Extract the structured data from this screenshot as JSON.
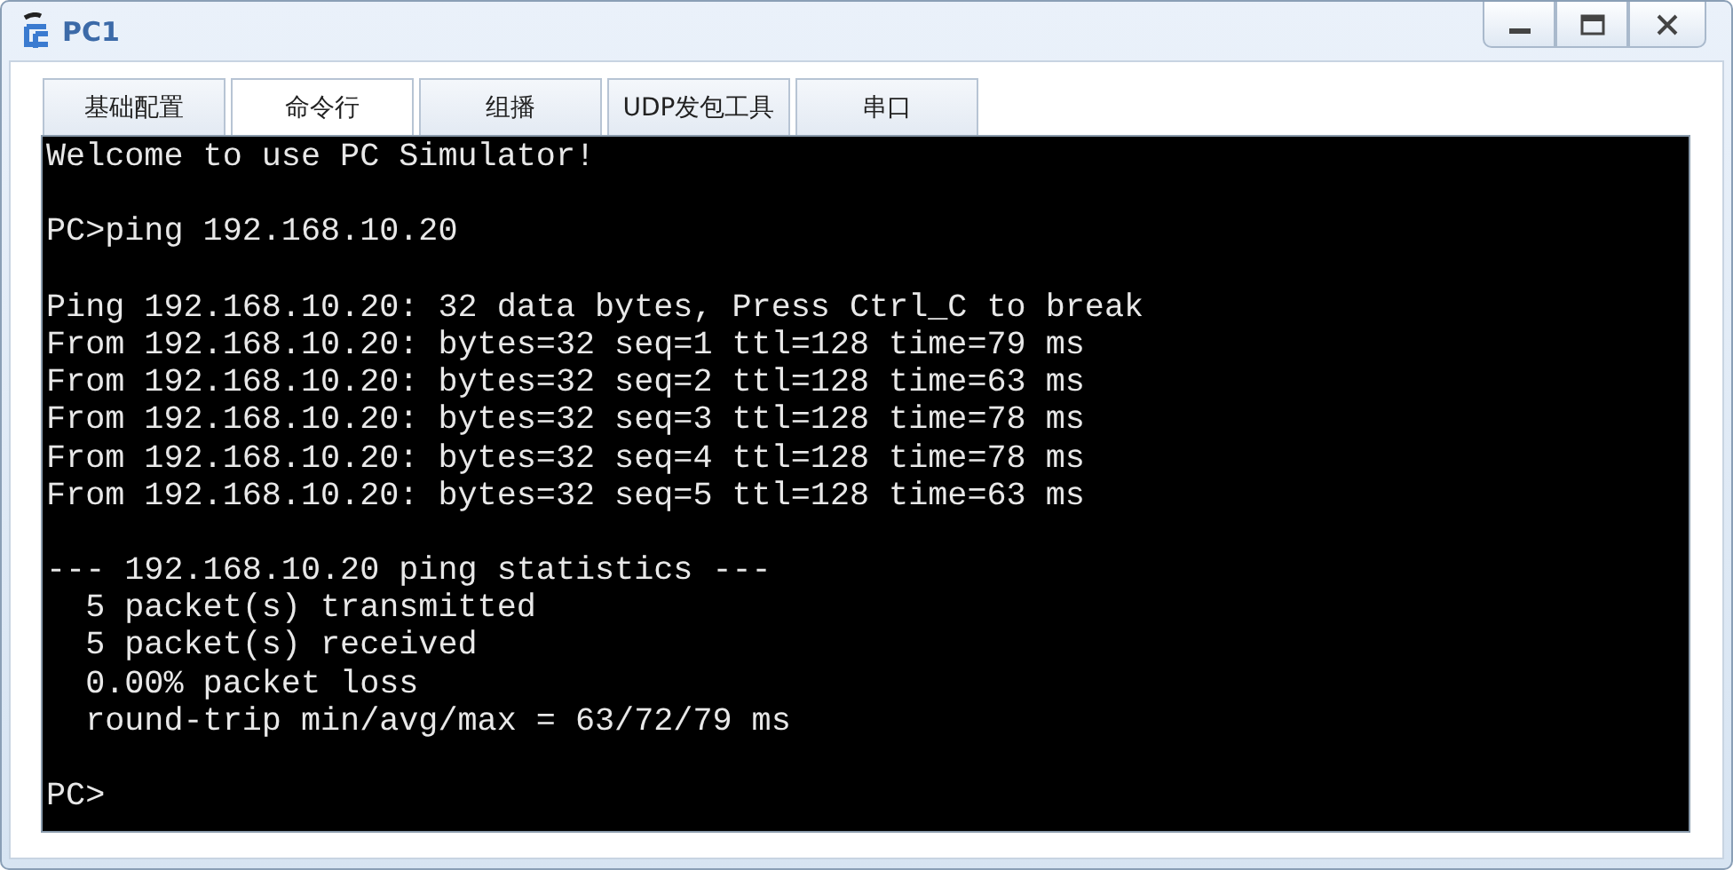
{
  "window": {
    "title": "PC1"
  },
  "tabs": [
    {
      "label": "基础配置",
      "selected": false
    },
    {
      "label": "命令行",
      "selected": true
    },
    {
      "label": "组播",
      "selected": false
    },
    {
      "label": "UDP发包工具",
      "selected": false
    },
    {
      "label": "串口",
      "selected": false
    }
  ],
  "terminal": {
    "blocks": [
      [
        "Welcome to use PC Simulator!"
      ],
      [
        "PC>ping 192.168.10.20"
      ],
      [
        "Ping 192.168.10.20: 32 data bytes, Press Ctrl_C to break",
        "From 192.168.10.20: bytes=32 seq=1 ttl=128 time=79 ms",
        "From 192.168.10.20: bytes=32 seq=2 ttl=128 time=63 ms",
        "From 192.168.10.20: bytes=32 seq=3 ttl=128 time=78 ms",
        "From 192.168.10.20: bytes=32 seq=4 ttl=128 time=78 ms",
        "From 192.168.10.20: bytes=32 seq=5 ttl=128 time=63 ms"
      ],
      [
        "--- 192.168.10.20 ping statistics ---",
        "  5 packet(s) transmitted",
        "  5 packet(s) received",
        "  0.00% packet loss",
        "  round-trip min/avg/max = 63/72/79 ms"
      ],
      [
        "PC>"
      ]
    ]
  }
}
